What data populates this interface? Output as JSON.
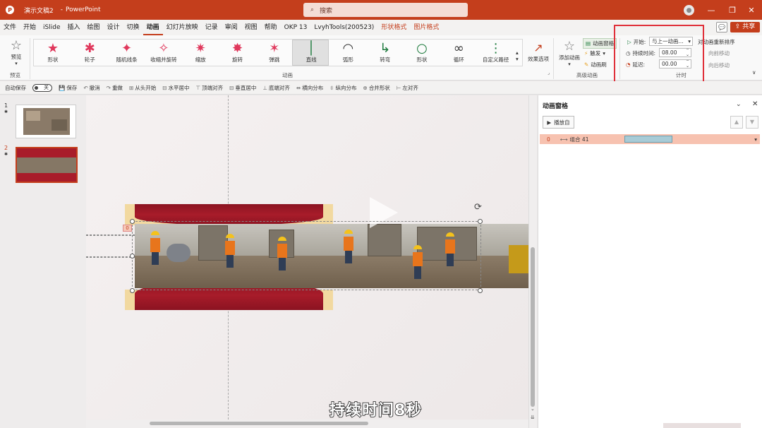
{
  "titlebar": {
    "doc_name": "演示文稿2",
    "separator": "-",
    "app_name": "PowerPoint",
    "search_placeholder": "搜索",
    "minimize": "—",
    "maximize": "❐",
    "close": "✕"
  },
  "menu": {
    "items": [
      "文件",
      "开始",
      "iSlide",
      "插入",
      "绘图",
      "设计",
      "切换",
      "动画",
      "幻灯片放映",
      "记录",
      "审阅",
      "视图",
      "帮助",
      "OKP 13",
      "LvyhTools(200523)",
      "形状格式",
      "图片格式"
    ],
    "active_index": 7,
    "contextual_indices": [
      15,
      16
    ],
    "share_label": "共享",
    "comment_glyph": "💬"
  },
  "ribbon": {
    "preview_label": "预览",
    "preview_group": "预览",
    "effects": [
      "形状",
      "轮子",
      "随机线条",
      "收缩并旋转",
      "缩放",
      "旋转",
      "弹跳",
      "直线",
      "弧形",
      "转弯",
      "形状",
      "循环",
      "自定义路径"
    ],
    "effects_group": "动画",
    "effect_options": "效果选项",
    "add_animation": "添加动画",
    "animation_pane": "动画窗格",
    "trigger": "触发",
    "animation_painter": "动画刷",
    "advanced_group": "高级动画",
    "start_label": "开始:",
    "start_value": "与上一动画...",
    "duration_label": "持续时间:",
    "duration_value": "08.00",
    "delay_label": "延迟:",
    "delay_value": "00.00",
    "reorder_title": "对动画重新排序",
    "move_earlier": "向前移动",
    "move_later": "向后移动",
    "timing_group": "计时",
    "highlight_color": "#e0303a"
  },
  "quickbar": {
    "autosave": "自动保存",
    "autosave_state": "关",
    "items": [
      "保存",
      "撤消",
      "重做",
      "从头开始",
      "水平居中",
      "顶端对齐",
      "垂直居中",
      "底端对齐",
      "横向分布",
      "纵向分布",
      "合并形状",
      "左对齐"
    ]
  },
  "slides": {
    "items": [
      {
        "num": "1",
        "star": "✱"
      },
      {
        "num": "2",
        "star": "✱"
      }
    ],
    "selected_index": 1
  },
  "canvas": {
    "anim_tag": "0",
    "subtitle": "持续时间8秒"
  },
  "animation_pane": {
    "title": "动画窗格",
    "play_label": "播放自",
    "row_index": "0",
    "row_label": "组合 41",
    "row_color": "#f7c2b0",
    "bar_color": "#a8cbd6"
  },
  "colors": {
    "brand": "#c43e1c",
    "band_red": "#a81c2a",
    "gold": "#f2d9a0"
  }
}
